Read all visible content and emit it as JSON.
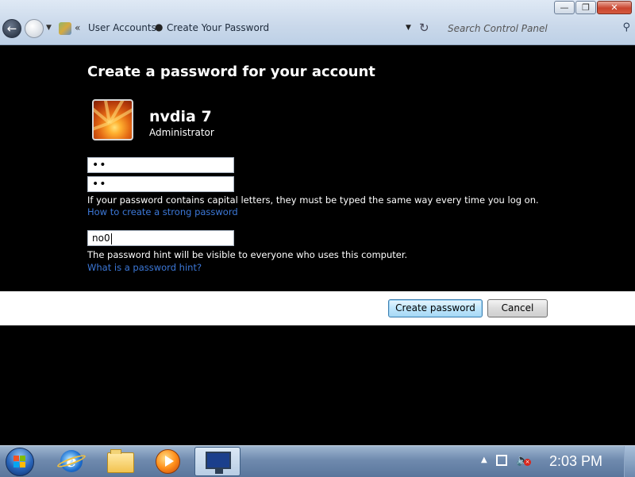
{
  "window": {
    "buttons": {
      "minimize": "—",
      "maximize": "❐",
      "close": "✕"
    }
  },
  "nav": {
    "back_icon": "back-arrow-icon",
    "breadcrumb": [
      "User Accounts",
      "Create Your Password"
    ],
    "search_placeholder": "Search Control Panel"
  },
  "main": {
    "heading": "Create a password for your account",
    "user": {
      "name": "nvdia 7",
      "role": "Administrator"
    },
    "password_value": "••",
    "confirm_value": "••",
    "caps_note": "If your password contains capital letters, they must be typed the same way every time you log on.",
    "strong_link": "How to create a strong password",
    "hint_value": "no0",
    "hint_note": "The password hint will be visible to everyone who uses this computer.",
    "hint_link": "What is a password hint?"
  },
  "buttons": {
    "create": "Create password",
    "cancel": "Cancel"
  },
  "taskbar": {
    "items": [
      "start-orb",
      "internet-explorer",
      "windows-explorer",
      "media-player",
      "control-panel"
    ],
    "clock": "2:03 PM"
  },
  "colors": {
    "background": "#000000",
    "link": "#3c78d8",
    "button_strip": "#ffffff"
  }
}
